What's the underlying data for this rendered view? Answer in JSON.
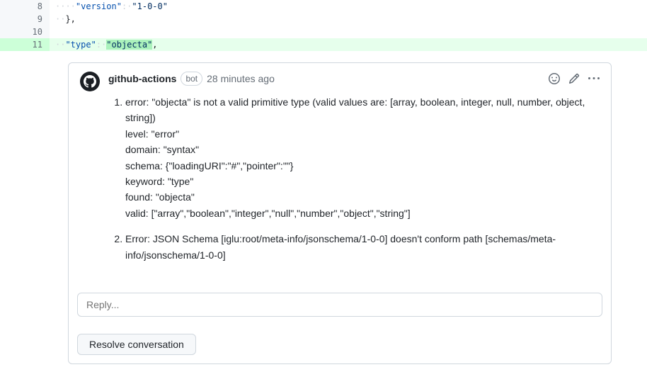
{
  "diff": {
    "lines": [
      {
        "num": "8",
        "type": "context",
        "prefix": "····",
        "key": "\"version\"",
        "colon": ":·",
        "val": "\"1-0-0\""
      },
      {
        "num": "9",
        "type": "context",
        "prefix": "··",
        "text": "},"
      },
      {
        "num": "10",
        "type": "context",
        "prefix": "",
        "text": ""
      },
      {
        "num": "11",
        "type": "addition",
        "prefix": "··",
        "key": "\"type\"",
        "colon": ":·",
        "val": "\"objecta\"",
        "trail": ","
      }
    ]
  },
  "comment": {
    "author": "github-actions",
    "badge": "bot",
    "timestamp": "28 minutes ago",
    "items": [
      {
        "lead": "error: \"objecta\" is not a valid primitive type (valid values are: [array, boolean, integer, null, number, object, string])",
        "lines": [
          "level: \"error\"",
          "domain: \"syntax\"",
          "schema: {\"loadingURI\":\"#\",\"pointer\":\"\"}",
          "keyword: \"type\"",
          "found: \"objecta\"",
          "valid: [\"array\",\"boolean\",\"integer\",\"null\",\"number\",\"object\",\"string\"]"
        ]
      },
      {
        "lead": "Error: JSON Schema [iglu:root/meta-info/jsonschema/1-0-0] doesn't conform path [schemas/meta-info/jsonschema/1-0-0]",
        "lines": []
      }
    ]
  },
  "reply": {
    "placeholder": "Reply..."
  },
  "actions": {
    "resolve": "Resolve conversation"
  }
}
